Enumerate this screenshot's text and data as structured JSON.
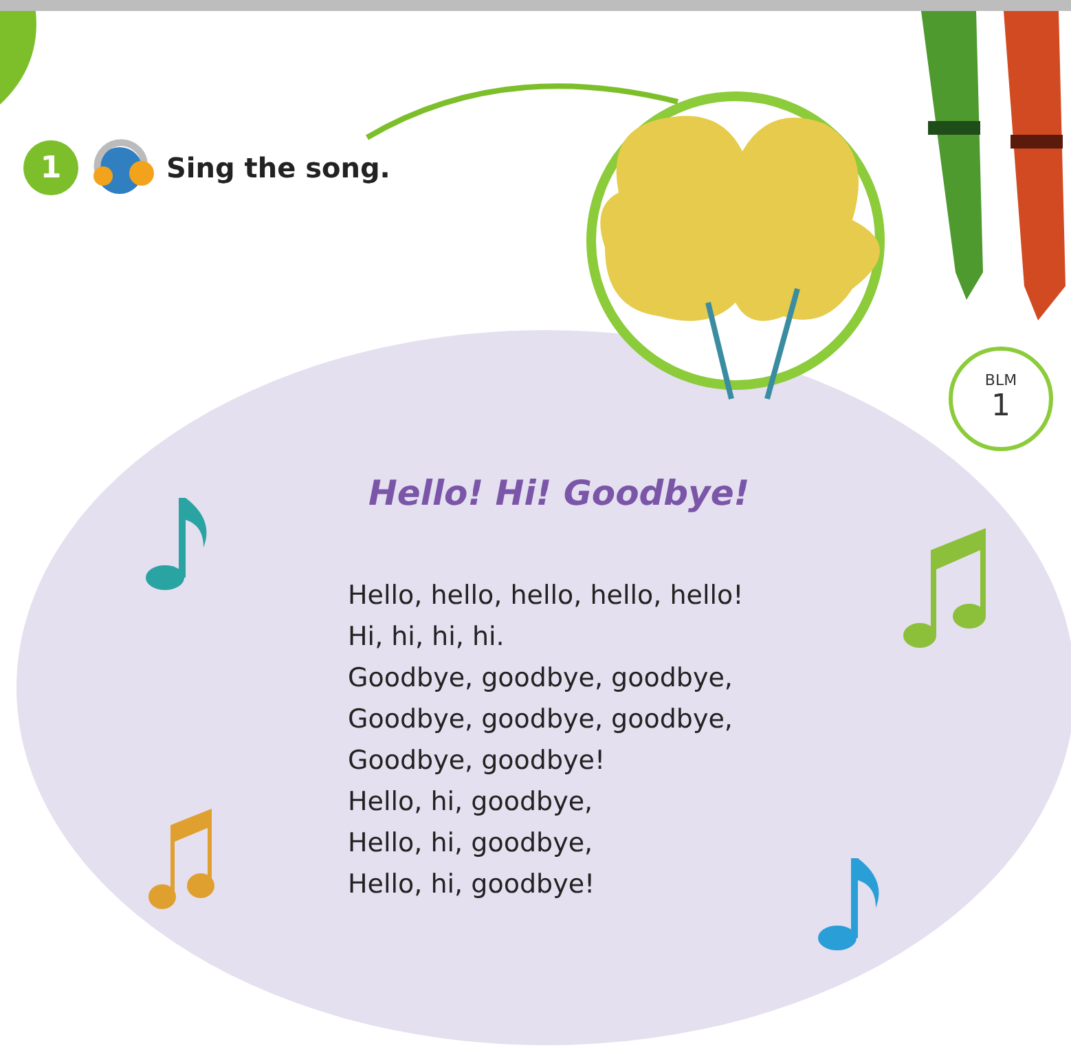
{
  "instruction": {
    "number": "1",
    "text": "Sing the song."
  },
  "badge": {
    "label": "BLM",
    "number": "1"
  },
  "song": {
    "title": "Hello! Hi! Goodbye!",
    "lines": [
      "Hello, hello, hello, hello, hello!",
      "Hi, hi, hi, hi.",
      "Goodbye, goodbye, goodbye,",
      "Goodbye, goodbye, goodbye,",
      "Goodbye, goodbye!",
      "Hello, hi, goodbye,",
      "Hello, hi, goodbye,",
      "Hello, hi, goodbye!"
    ]
  }
}
